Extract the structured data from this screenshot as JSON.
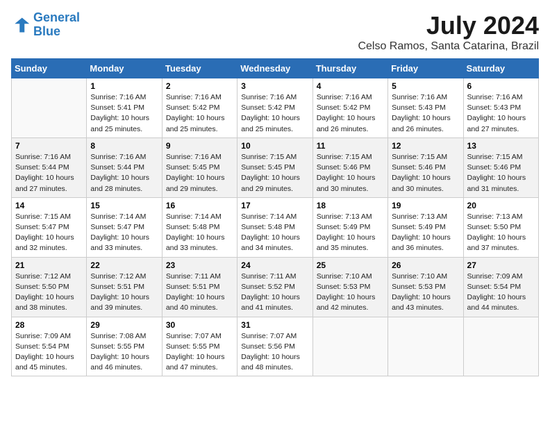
{
  "header": {
    "logo_line1": "General",
    "logo_line2": "Blue",
    "month_year": "July 2024",
    "location": "Celso Ramos, Santa Catarina, Brazil"
  },
  "weekdays": [
    "Sunday",
    "Monday",
    "Tuesday",
    "Wednesday",
    "Thursday",
    "Friday",
    "Saturday"
  ],
  "weeks": [
    [
      {
        "day": "",
        "info": ""
      },
      {
        "day": "1",
        "info": "Sunrise: 7:16 AM\nSunset: 5:41 PM\nDaylight: 10 hours\nand 25 minutes."
      },
      {
        "day": "2",
        "info": "Sunrise: 7:16 AM\nSunset: 5:42 PM\nDaylight: 10 hours\nand 25 minutes."
      },
      {
        "day": "3",
        "info": "Sunrise: 7:16 AM\nSunset: 5:42 PM\nDaylight: 10 hours\nand 25 minutes."
      },
      {
        "day": "4",
        "info": "Sunrise: 7:16 AM\nSunset: 5:42 PM\nDaylight: 10 hours\nand 26 minutes."
      },
      {
        "day": "5",
        "info": "Sunrise: 7:16 AM\nSunset: 5:43 PM\nDaylight: 10 hours\nand 26 minutes."
      },
      {
        "day": "6",
        "info": "Sunrise: 7:16 AM\nSunset: 5:43 PM\nDaylight: 10 hours\nand 27 minutes."
      }
    ],
    [
      {
        "day": "7",
        "info": "Sunrise: 7:16 AM\nSunset: 5:44 PM\nDaylight: 10 hours\nand 27 minutes."
      },
      {
        "day": "8",
        "info": "Sunrise: 7:16 AM\nSunset: 5:44 PM\nDaylight: 10 hours\nand 28 minutes."
      },
      {
        "day": "9",
        "info": "Sunrise: 7:16 AM\nSunset: 5:45 PM\nDaylight: 10 hours\nand 29 minutes."
      },
      {
        "day": "10",
        "info": "Sunrise: 7:15 AM\nSunset: 5:45 PM\nDaylight: 10 hours\nand 29 minutes."
      },
      {
        "day": "11",
        "info": "Sunrise: 7:15 AM\nSunset: 5:46 PM\nDaylight: 10 hours\nand 30 minutes."
      },
      {
        "day": "12",
        "info": "Sunrise: 7:15 AM\nSunset: 5:46 PM\nDaylight: 10 hours\nand 30 minutes."
      },
      {
        "day": "13",
        "info": "Sunrise: 7:15 AM\nSunset: 5:46 PM\nDaylight: 10 hours\nand 31 minutes."
      }
    ],
    [
      {
        "day": "14",
        "info": "Sunrise: 7:15 AM\nSunset: 5:47 PM\nDaylight: 10 hours\nand 32 minutes."
      },
      {
        "day": "15",
        "info": "Sunrise: 7:14 AM\nSunset: 5:47 PM\nDaylight: 10 hours\nand 33 minutes."
      },
      {
        "day": "16",
        "info": "Sunrise: 7:14 AM\nSunset: 5:48 PM\nDaylight: 10 hours\nand 33 minutes."
      },
      {
        "day": "17",
        "info": "Sunrise: 7:14 AM\nSunset: 5:48 PM\nDaylight: 10 hours\nand 34 minutes."
      },
      {
        "day": "18",
        "info": "Sunrise: 7:13 AM\nSunset: 5:49 PM\nDaylight: 10 hours\nand 35 minutes."
      },
      {
        "day": "19",
        "info": "Sunrise: 7:13 AM\nSunset: 5:49 PM\nDaylight: 10 hours\nand 36 minutes."
      },
      {
        "day": "20",
        "info": "Sunrise: 7:13 AM\nSunset: 5:50 PM\nDaylight: 10 hours\nand 37 minutes."
      }
    ],
    [
      {
        "day": "21",
        "info": "Sunrise: 7:12 AM\nSunset: 5:50 PM\nDaylight: 10 hours\nand 38 minutes."
      },
      {
        "day": "22",
        "info": "Sunrise: 7:12 AM\nSunset: 5:51 PM\nDaylight: 10 hours\nand 39 minutes."
      },
      {
        "day": "23",
        "info": "Sunrise: 7:11 AM\nSunset: 5:51 PM\nDaylight: 10 hours\nand 40 minutes."
      },
      {
        "day": "24",
        "info": "Sunrise: 7:11 AM\nSunset: 5:52 PM\nDaylight: 10 hours\nand 41 minutes."
      },
      {
        "day": "25",
        "info": "Sunrise: 7:10 AM\nSunset: 5:53 PM\nDaylight: 10 hours\nand 42 minutes."
      },
      {
        "day": "26",
        "info": "Sunrise: 7:10 AM\nSunset: 5:53 PM\nDaylight: 10 hours\nand 43 minutes."
      },
      {
        "day": "27",
        "info": "Sunrise: 7:09 AM\nSunset: 5:54 PM\nDaylight: 10 hours\nand 44 minutes."
      }
    ],
    [
      {
        "day": "28",
        "info": "Sunrise: 7:09 AM\nSunset: 5:54 PM\nDaylight: 10 hours\nand 45 minutes."
      },
      {
        "day": "29",
        "info": "Sunrise: 7:08 AM\nSunset: 5:55 PM\nDaylight: 10 hours\nand 46 minutes."
      },
      {
        "day": "30",
        "info": "Sunrise: 7:07 AM\nSunset: 5:55 PM\nDaylight: 10 hours\nand 47 minutes."
      },
      {
        "day": "31",
        "info": "Sunrise: 7:07 AM\nSunset: 5:56 PM\nDaylight: 10 hours\nand 48 minutes."
      },
      {
        "day": "",
        "info": ""
      },
      {
        "day": "",
        "info": ""
      },
      {
        "day": "",
        "info": ""
      }
    ]
  ]
}
